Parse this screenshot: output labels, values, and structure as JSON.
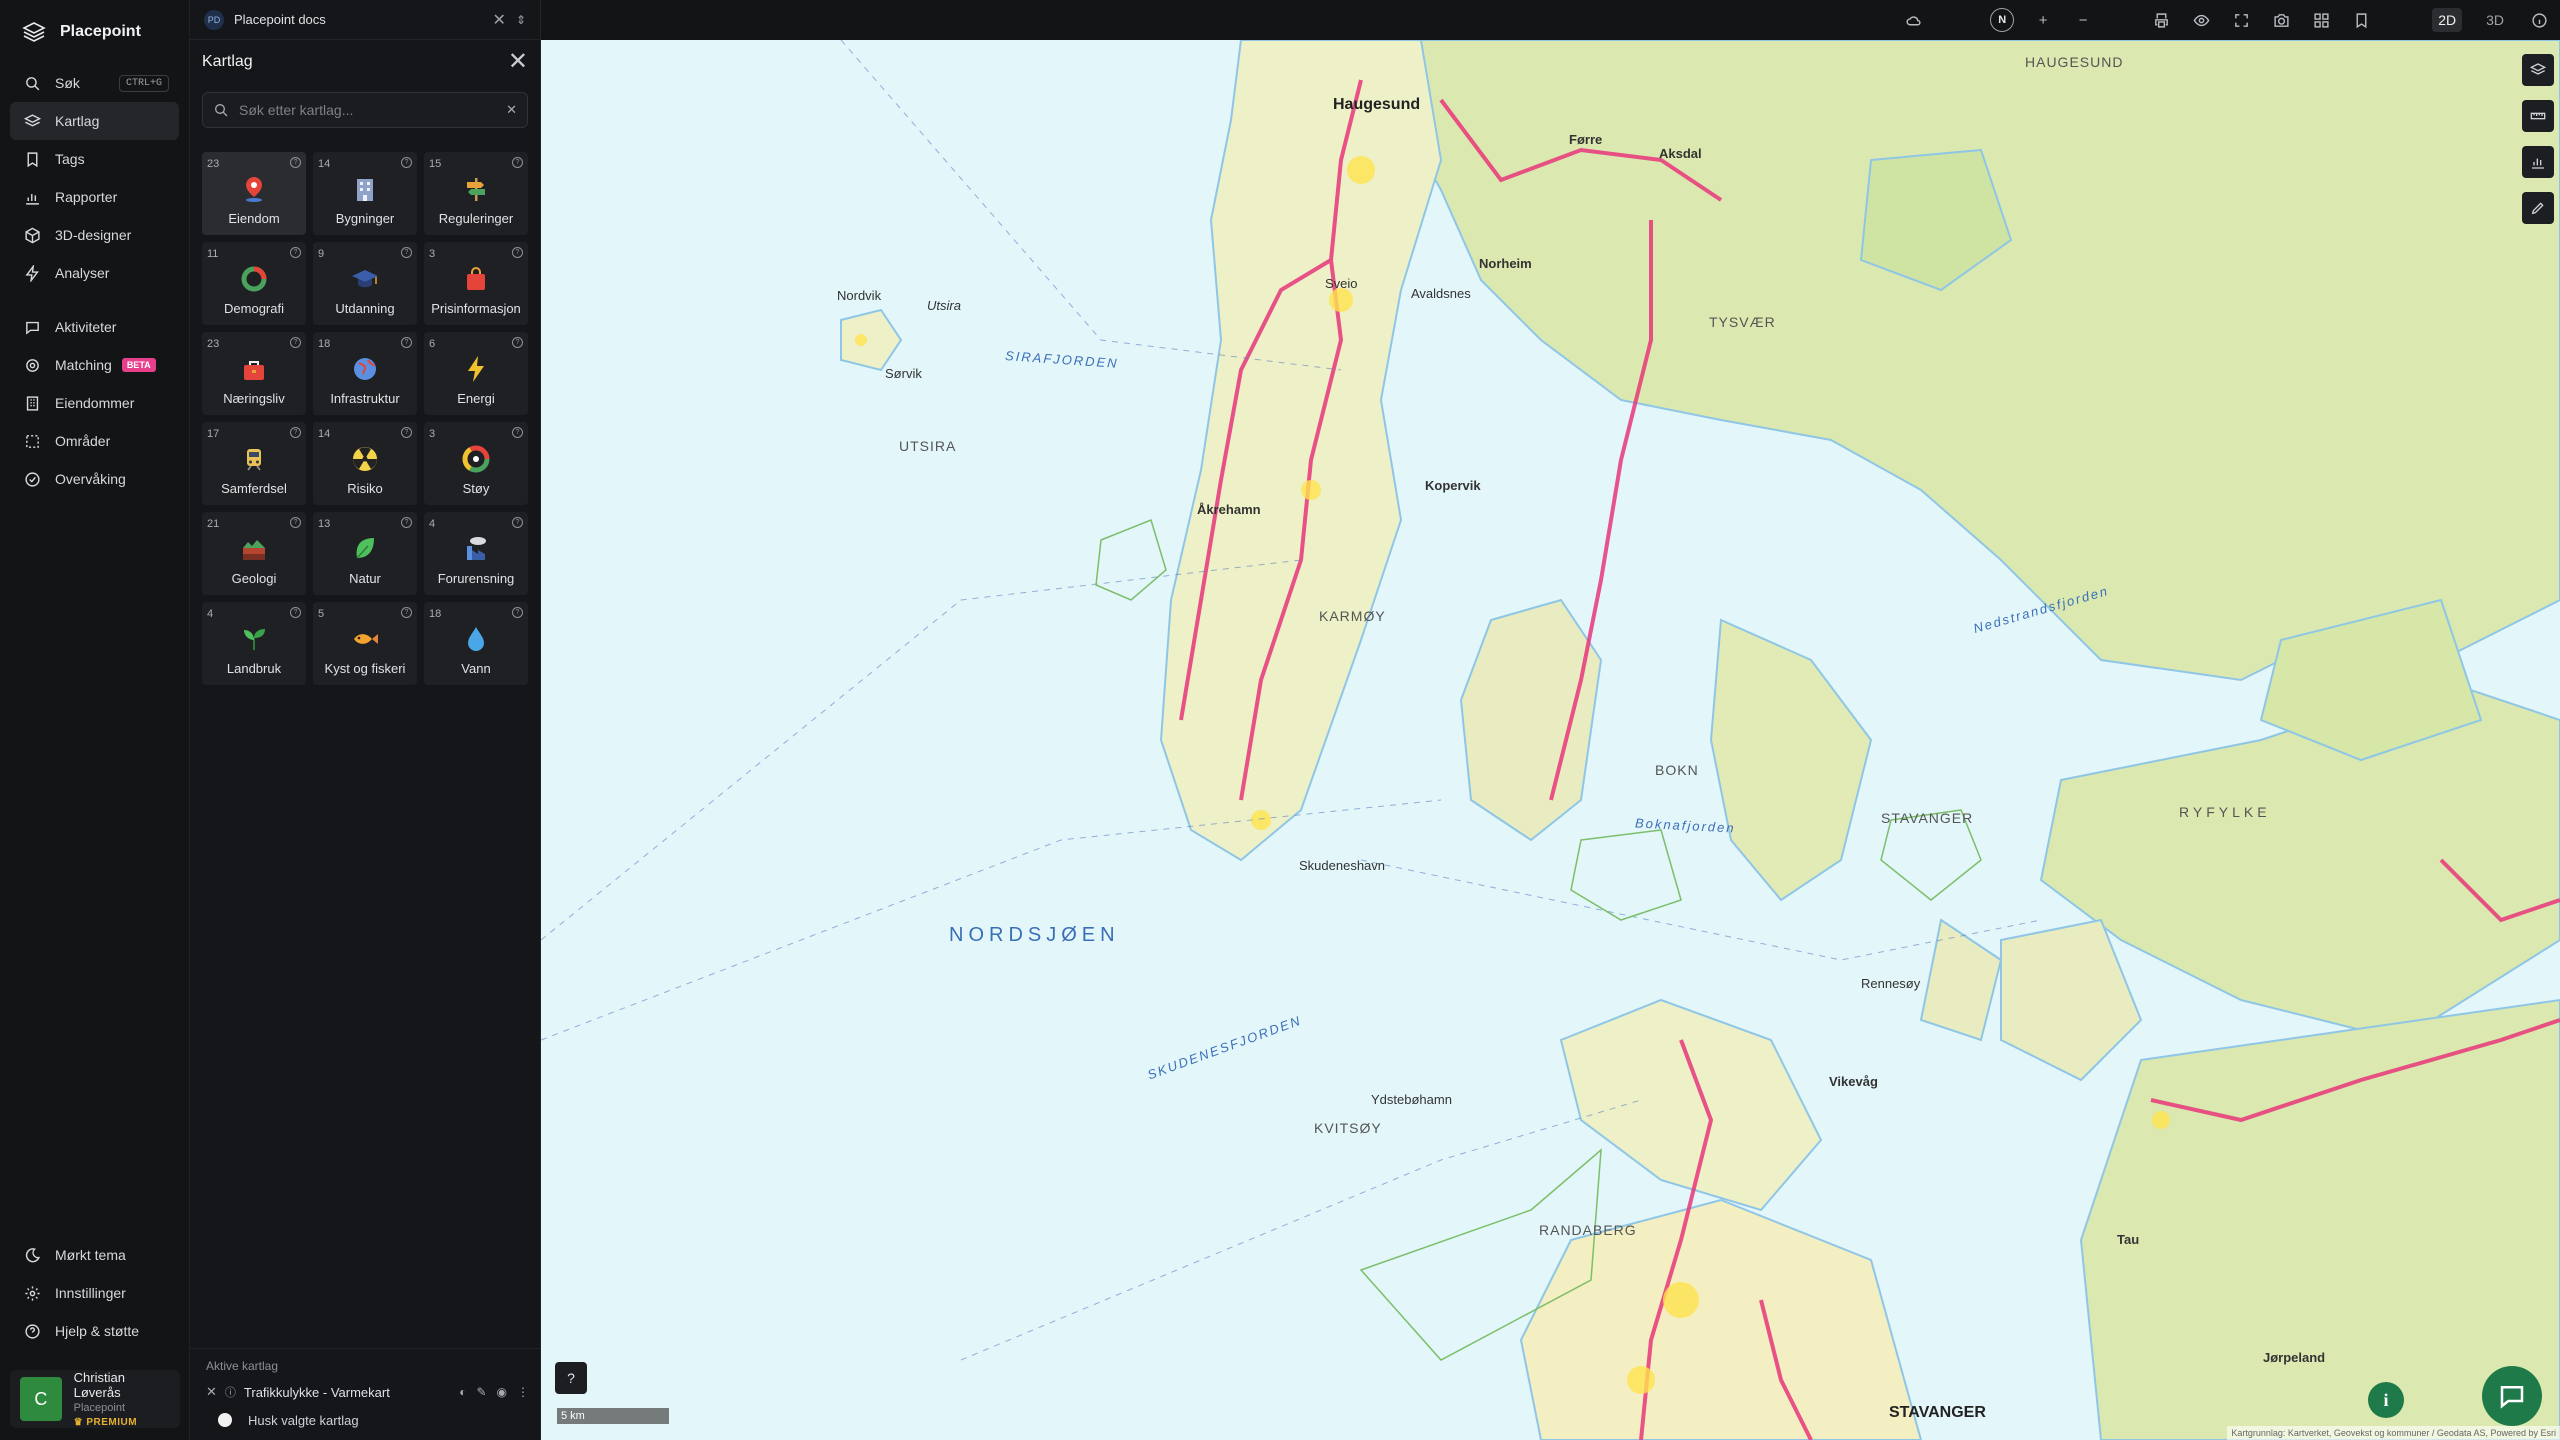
{
  "brand": {
    "name": "Placepoint"
  },
  "nav": {
    "items": [
      {
        "label": "Søk",
        "shortcut": "CTRL+G"
      },
      {
        "label": "Kartlag"
      },
      {
        "label": "Tags"
      },
      {
        "label": "Rapporter"
      },
      {
        "label": "3D-designer"
      },
      {
        "label": "Analyser"
      },
      {
        "label": "Aktiviteter"
      },
      {
        "label": "Matching",
        "badge": "BETA"
      },
      {
        "label": "Eiendommer"
      },
      {
        "label": "Områder"
      },
      {
        "label": "Overvåking"
      }
    ],
    "bottom": [
      {
        "label": "Mørkt tema"
      },
      {
        "label": "Innstillinger"
      },
      {
        "label": "Hjelp & støtte"
      }
    ]
  },
  "user": {
    "initial": "C",
    "name": "Christian Løverås",
    "org": "Placepoint",
    "plan": "PREMIUM"
  },
  "doc_tab": {
    "badge": "PD",
    "title": "Placepoint docs"
  },
  "panel": {
    "title": "Kartlag",
    "search_placeholder": "Søk etter kartlag...",
    "categories": [
      {
        "count": "23",
        "label": "Eiendom"
      },
      {
        "count": "14",
        "label": "Bygninger"
      },
      {
        "count": "15",
        "label": "Reguleringer"
      },
      {
        "count": "11",
        "label": "Demografi"
      },
      {
        "count": "9",
        "label": "Utdanning"
      },
      {
        "count": "3",
        "label": "Prisinformasjon"
      },
      {
        "count": "23",
        "label": "Næringsliv"
      },
      {
        "count": "18",
        "label": "Infrastruktur"
      },
      {
        "count": "6",
        "label": "Energi"
      },
      {
        "count": "17",
        "label": "Samferdsel"
      },
      {
        "count": "14",
        "label": "Risiko"
      },
      {
        "count": "3",
        "label": "Støy"
      },
      {
        "count": "21",
        "label": "Geologi"
      },
      {
        "count": "13",
        "label": "Natur"
      },
      {
        "count": "4",
        "label": "Forurensning"
      },
      {
        "count": "4",
        "label": "Landbruk"
      },
      {
        "count": "5",
        "label": "Kyst og fiskeri"
      },
      {
        "count": "18",
        "label": "Vann"
      }
    ],
    "active_header": "Aktive kartlag",
    "active_layer": "Trafikkulykke - Varmekart",
    "remember_label": "Husk valgte kartlag"
  },
  "topbar": {
    "compass": "N",
    "mode_2d": "2D",
    "mode_3d": "3D"
  },
  "map": {
    "places": [
      {
        "t": "Haugesund",
        "c": "big"
      },
      {
        "t": "Kopervik",
        "c": ""
      },
      {
        "t": "Åkrehamn",
        "c": ""
      },
      {
        "t": "KARMØY",
        "c": "region"
      },
      {
        "t": "Skudeneshavn",
        "c": ""
      },
      {
        "t": "UTSIRA",
        "c": "region"
      },
      {
        "t": "Utsira",
        "c": ""
      },
      {
        "t": "Nordvik",
        "c": ""
      },
      {
        "t": "Sørvik",
        "c": ""
      },
      {
        "t": "SIRAFJORDEN",
        "c": "water"
      },
      {
        "t": "NORDSJØEN",
        "c": "sea"
      },
      {
        "t": "SKUDENESFJORDEN",
        "c": "water"
      },
      {
        "t": "KVITSØY",
        "c": "region"
      },
      {
        "t": "Ydstebøhamn",
        "c": ""
      },
      {
        "t": "BOKN",
        "c": "region"
      },
      {
        "t": "Boknafjorden",
        "c": "water"
      },
      {
        "t": "STAVANGER",
        "c": "region"
      },
      {
        "t": "TYSVÆR",
        "c": "region"
      },
      {
        "t": "HAUGESUND",
        "c": "region"
      },
      {
        "t": "RYFYLKE",
        "c": "region"
      },
      {
        "t": "RANDABERG",
        "c": "region"
      },
      {
        "t": "STAVANGER",
        "c": "big"
      },
      {
        "t": "Nedstrandsfjorden",
        "c": "water"
      },
      {
        "t": "Jørpeland",
        "c": ""
      },
      {
        "t": "Tau",
        "c": ""
      },
      {
        "t": "Rennesøy",
        "c": ""
      },
      {
        "t": "Vikevåg",
        "c": ""
      },
      {
        "t": "Aksdal",
        "c": ""
      },
      {
        "t": "Førre",
        "c": ""
      },
      {
        "t": "Avaldsnes",
        "c": ""
      },
      {
        "t": "Norheim",
        "c": ""
      },
      {
        "t": "Sveio",
        "c": ""
      }
    ],
    "scale_label": "5 km",
    "attribution": "Kartgrunnlag: Kartverket, Geovekst og kommuner / Geodata AS, Powered by Esri"
  }
}
